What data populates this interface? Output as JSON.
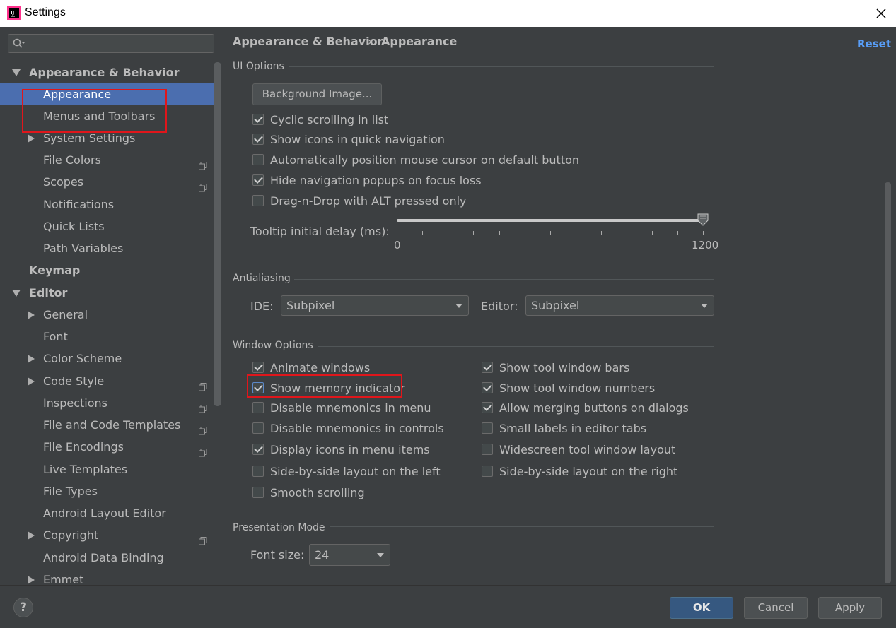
{
  "window": {
    "title": "Settings"
  },
  "search": {
    "placeholder": ""
  },
  "sidebar": {
    "items": [
      {
        "label": "Appearance & Behavior"
      },
      {
        "label": "Appearance"
      },
      {
        "label": "Menus and Toolbars"
      },
      {
        "label": "System Settings"
      },
      {
        "label": "File Colors"
      },
      {
        "label": "Scopes"
      },
      {
        "label": "Notifications"
      },
      {
        "label": "Quick Lists"
      },
      {
        "label": "Path Variables"
      },
      {
        "label": "Keymap"
      },
      {
        "label": "Editor"
      },
      {
        "label": "General"
      },
      {
        "label": "Font"
      },
      {
        "label": "Color Scheme"
      },
      {
        "label": "Code Style"
      },
      {
        "label": "Inspections"
      },
      {
        "label": "File and Code Templates"
      },
      {
        "label": "File Encodings"
      },
      {
        "label": "Live Templates"
      },
      {
        "label": "File Types"
      },
      {
        "label": "Android Layout Editor"
      },
      {
        "label": "Copyright"
      },
      {
        "label": "Android Data Binding"
      },
      {
        "label": "Emmet"
      }
    ]
  },
  "breadcrumb": {
    "parent": "Appearance & Behavior",
    "separator": "›",
    "current": "Appearance"
  },
  "reset_label": "Reset",
  "ui_options": {
    "title": "UI Options",
    "background_button": "Background Image...",
    "checkboxes": [
      {
        "label": "Cyclic scrolling in list",
        "checked": true
      },
      {
        "label": "Show icons in quick navigation",
        "checked": true
      },
      {
        "label": "Automatically position mouse cursor on default button",
        "checked": false
      },
      {
        "label": "Hide navigation popups on focus loss",
        "checked": true
      },
      {
        "label": "Drag-n-Drop with ALT pressed only",
        "checked": false
      }
    ],
    "tooltip_label": "Tooltip initial delay (ms):",
    "tooltip_min": "0",
    "tooltip_max": "1200",
    "tooltip_value": 1200
  },
  "antialiasing": {
    "title": "Antialiasing",
    "ide_label": "IDE:",
    "ide_value": "Subpixel",
    "editor_label": "Editor:",
    "editor_value": "Subpixel"
  },
  "window_options": {
    "title": "Window Options",
    "left": [
      {
        "label": "Animate windows",
        "checked": true
      },
      {
        "label": "Show memory indicator",
        "checked": true
      },
      {
        "label": "Disable mnemonics in menu",
        "checked": false
      },
      {
        "label": "Disable mnemonics in controls",
        "checked": false
      },
      {
        "label": "Display icons in menu items",
        "checked": true
      },
      {
        "label": "Side-by-side layout on the left",
        "checked": false
      },
      {
        "label": "Smooth scrolling",
        "checked": false
      }
    ],
    "right": [
      {
        "label": "Show tool window bars",
        "checked": true
      },
      {
        "label": "Show tool window numbers",
        "checked": true
      },
      {
        "label": "Allow merging buttons on dialogs",
        "checked": true
      },
      {
        "label": "Small labels in editor tabs",
        "checked": false
      },
      {
        "label": "Widescreen tool window layout",
        "checked": false
      },
      {
        "label": "Side-by-side layout on the right",
        "checked": false
      }
    ]
  },
  "presentation": {
    "title": "Presentation Mode",
    "font_size_label": "Font size:",
    "font_size_value": "24"
  },
  "footer": {
    "help": "?",
    "ok": "OK",
    "cancel": "Cancel",
    "apply": "Apply"
  },
  "colors": {
    "accent": "#4b6eaf",
    "link": "#589df6",
    "highlight": "#e0161b",
    "background": "#3c3f41"
  }
}
